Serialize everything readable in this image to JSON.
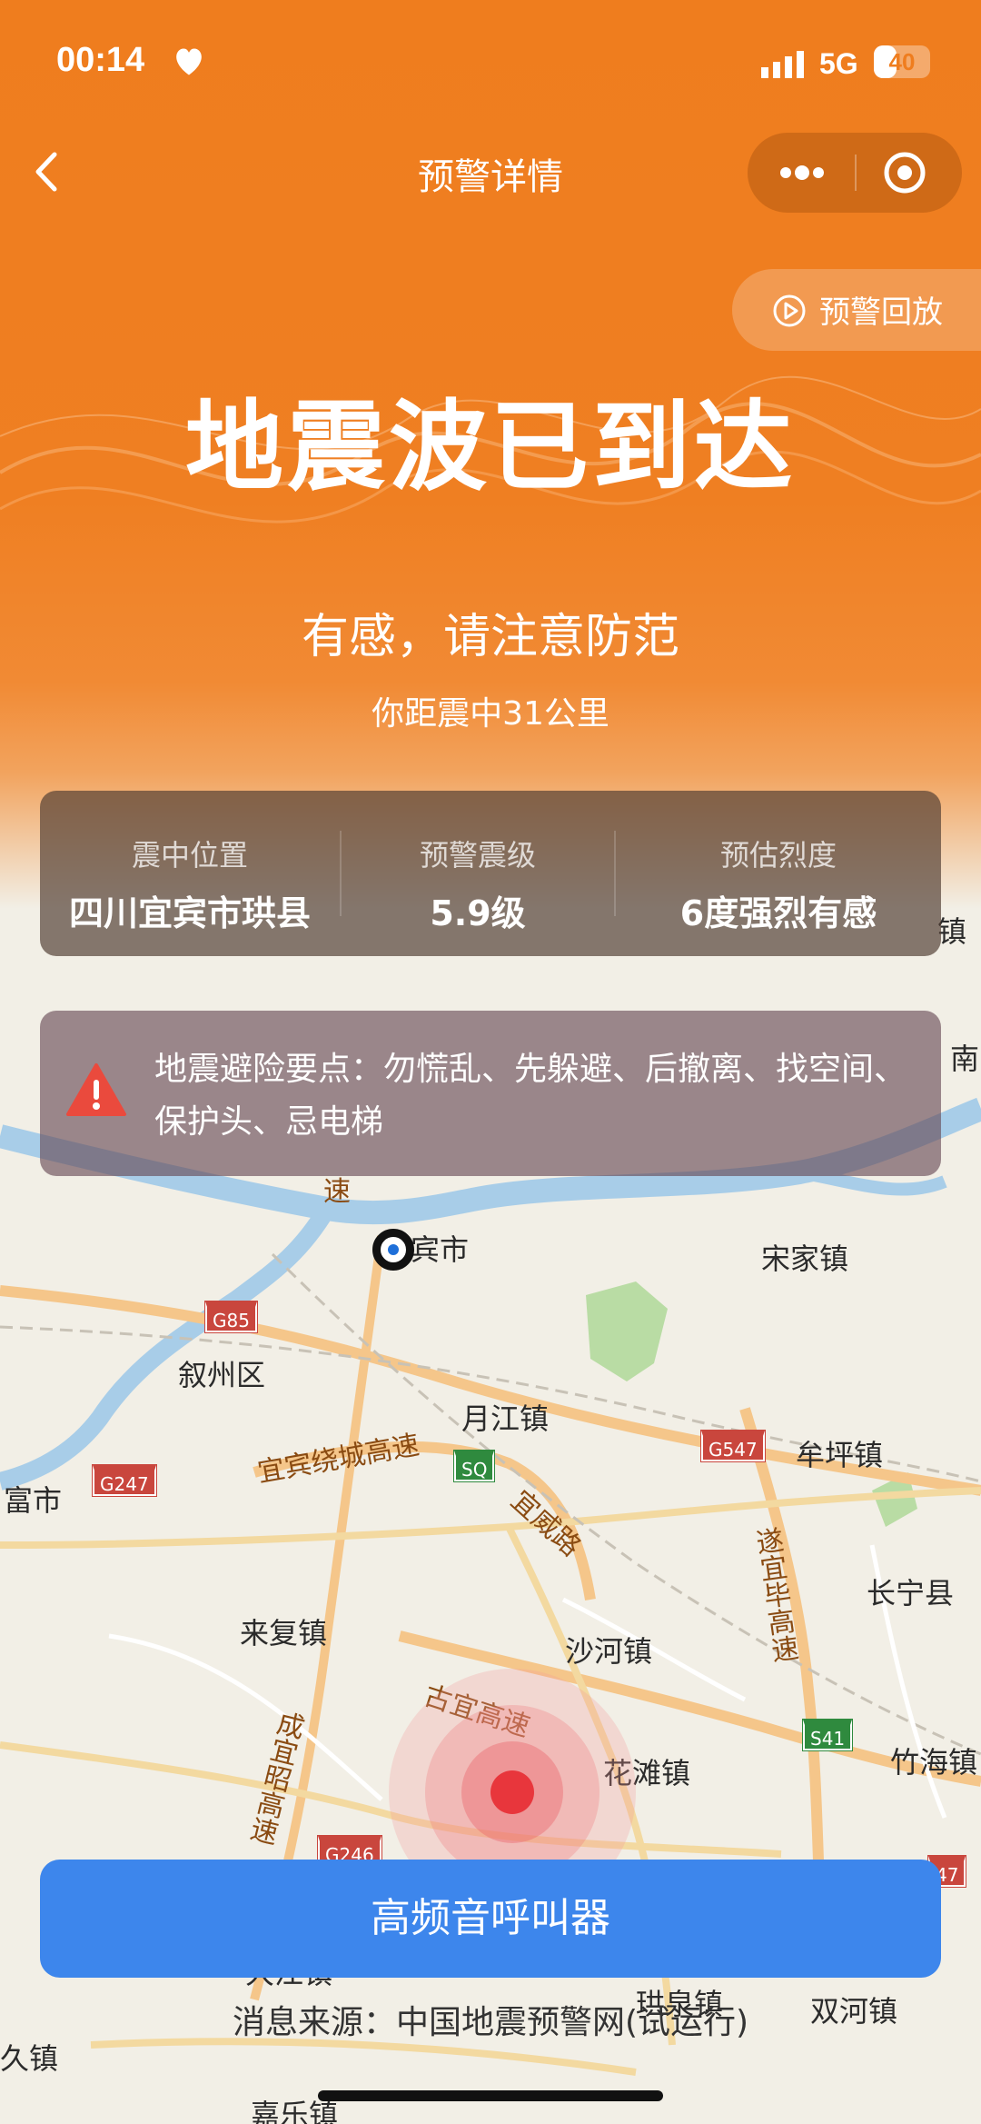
{
  "status_bar": {
    "time": "00:14",
    "network": "5G",
    "battery": "40",
    "battery_level": 0.4
  },
  "nav": {
    "title": "预警详情"
  },
  "replay": {
    "label": "预警回放"
  },
  "alert": {
    "headline": "地震波已到达",
    "subline": "有感，请注意防范",
    "distance": "你距震中31公里"
  },
  "info": {
    "location_label": "震中位置",
    "location_value": "四川宜宾市珙县",
    "magnitude_label": "预警震级",
    "magnitude_value": "5.9级",
    "intensity_label": "预估烈度",
    "intensity_value": "6度强烈有感"
  },
  "tips": {
    "text": "地震避险要点：勿慌乱、先躲避、后撤离、找空间、保护头、忌电梯"
  },
  "map": {
    "places": [
      "镇",
      "南",
      "宾市",
      "宋家镇",
      "叙州区",
      "月江镇",
      "牟坪镇",
      "富市",
      "长宁县",
      "来复镇",
      "沙河镇",
      "花滩镇",
      "竹海镇",
      "双河镇",
      "珙泉镇",
      "久镇",
      "嘉乐镇",
      "大江镇"
    ],
    "roads": [
      "宜宾绕城高速",
      "宜威路",
      "遂宜毕高速",
      "古宜高速",
      "成宜昭高速",
      "速"
    ],
    "shields": [
      "G85",
      "G247",
      "SQ",
      "G547",
      "S41",
      "G246",
      "47"
    ]
  },
  "beeper": {
    "label": "高频音呼叫器"
  },
  "source": {
    "text": "消息来源：中国地震预警网(试运行)"
  },
  "colors": {
    "accent": "#ef7d1e",
    "button": "#3d86ec",
    "epicenter": "#e8363c"
  }
}
